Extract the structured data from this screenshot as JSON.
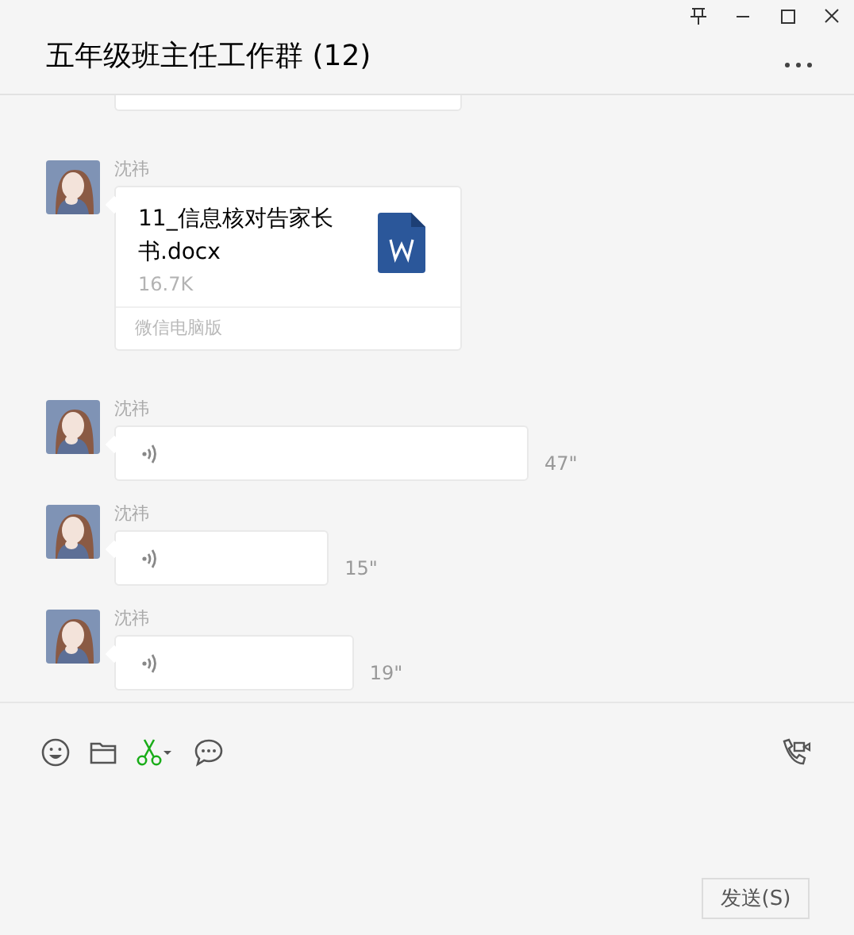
{
  "window": {
    "title": "五年级班主任工作群 (12)"
  },
  "messages": [
    {
      "kind": "cut_card"
    },
    {
      "kind": "file",
      "sender": "沈祎",
      "file_name": "11_信息核对告家长书.docx",
      "file_size": "16.7K",
      "source": "微信电脑版"
    },
    {
      "kind": "voice",
      "sender": "沈祎",
      "duration": "47\""
    },
    {
      "kind": "voice",
      "sender": "沈祎",
      "duration": "15\""
    },
    {
      "kind": "voice",
      "sender": "沈祎",
      "duration": "19\""
    }
  ],
  "send_button": {
    "label": "发送(S)"
  }
}
